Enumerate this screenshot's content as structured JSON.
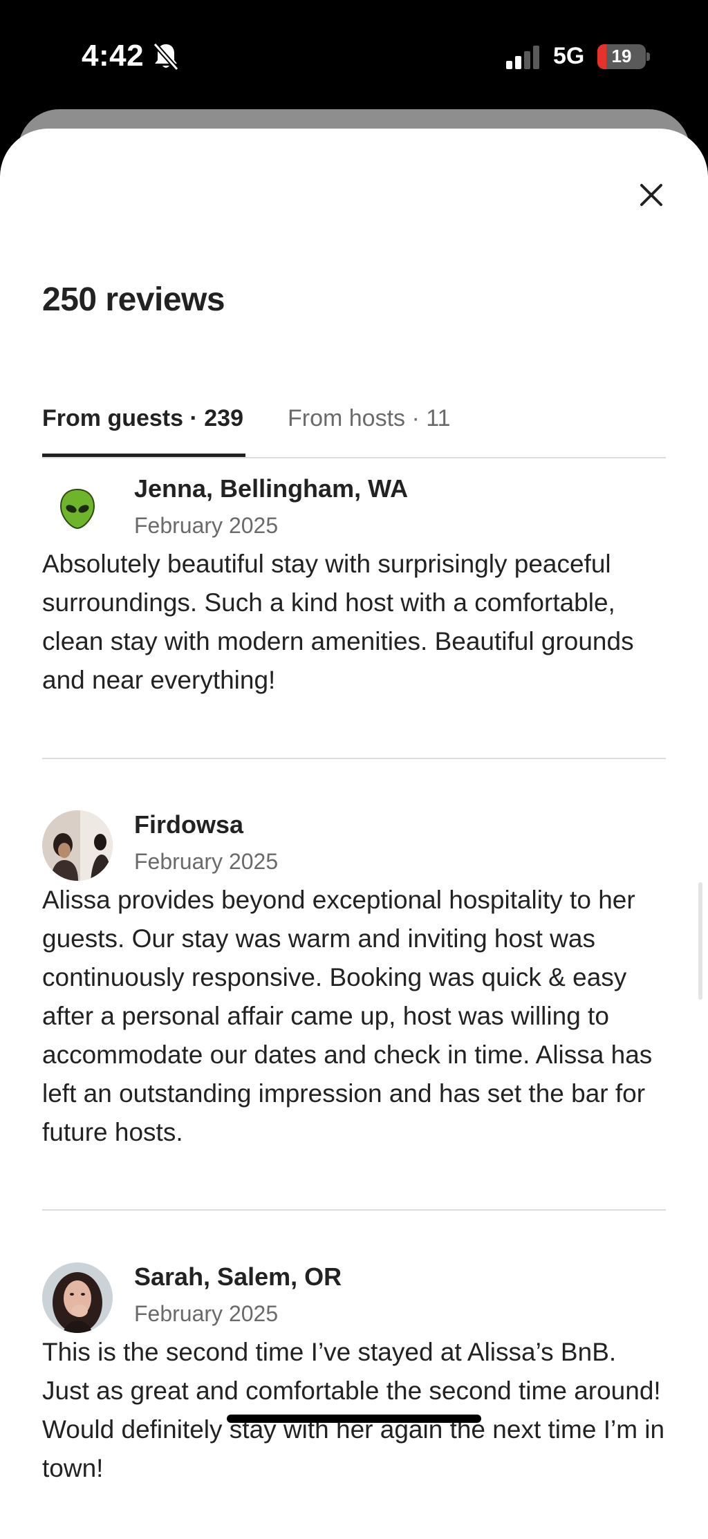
{
  "status_bar": {
    "time": "4:42",
    "network": "5G",
    "battery_level": "19",
    "battery_fraction": 0.19
  },
  "sheet": {
    "title": "250 reviews",
    "close_icon": "close-icon"
  },
  "tabs": [
    {
      "label": "From guests · 239",
      "active": true
    },
    {
      "label": "From hosts · 11",
      "active": false
    }
  ],
  "reviews": [
    {
      "name": "Jenna, Bellingham, WA",
      "date": "February 2025",
      "text": "Absolutely beautiful stay with surprisingly peaceful surroundings. Such a kind host with a comfortable, clean stay with modern amenities. Beautiful grounds and near everything!",
      "avatar": "alien-avatar"
    },
    {
      "name": "Firdowsa",
      "date": "February 2025",
      "text": "Alissa provides beyond exceptional hospitality to her guests. Our stay was warm and inviting host was continuously responsive. Booking was quick & easy after a personal affair came up, host was willing to accommodate our dates and check in time. Alissa has left an outstanding impression and has set the bar for future hosts.",
      "avatar": "photo-avatar"
    },
    {
      "name": "Sarah, Salem, OR",
      "date": "February 2025",
      "text": "This is the second time I’ve stayed at Alissa’s BnB. Just as great and comfortable the second time around! Would definitely stay with her again the next time I’m in town!",
      "avatar": "photo-avatar"
    }
  ],
  "colors": {
    "text_primary": "#222222",
    "text_secondary": "#6a6a6a",
    "divider": "#dddddd",
    "battery_low": "#e5322b",
    "alien_green": "#6fb52c"
  }
}
